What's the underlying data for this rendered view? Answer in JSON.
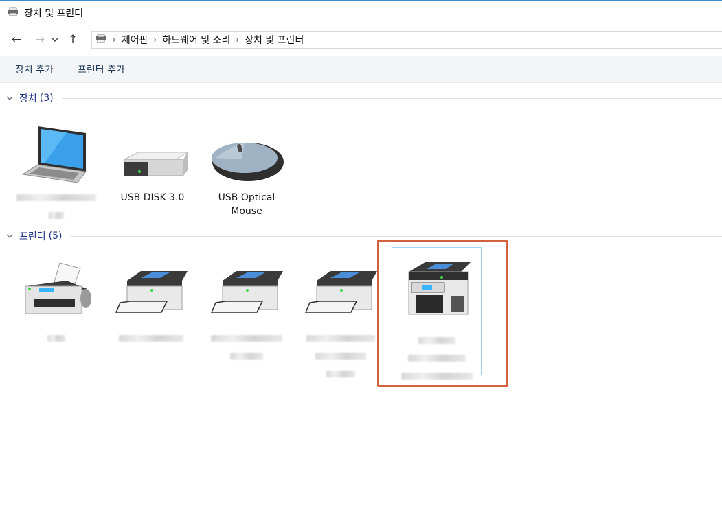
{
  "window": {
    "title": "장치 및 프린터",
    "icon": "devices-printers-icon"
  },
  "nav": {
    "back": "←",
    "forward": "→",
    "recent": "⌄",
    "up": "↑"
  },
  "breadcrumb": {
    "separator": "›",
    "items": [
      "제어판",
      "하드웨어 및 소리",
      "장치 및 프린터"
    ]
  },
  "toolbar": {
    "add_device": "장치 추가",
    "add_printer": "프린터 추가"
  },
  "groups": {
    "devices": {
      "title": "장치",
      "count": "(3)",
      "items": [
        {
          "label": "",
          "icon": "laptop-icon",
          "blurred": true
        },
        {
          "label": "USB DISK 3.0",
          "icon": "usb-drive-icon",
          "blurred": false
        },
        {
          "label": "USB Optical Mouse",
          "icon": "mouse-icon",
          "blurred": false
        }
      ]
    },
    "printers": {
      "title": "프린터",
      "count": "(5)",
      "items": [
        {
          "label": "",
          "icon": "fax-icon",
          "blurred": true
        },
        {
          "label": "",
          "icon": "printer-icon",
          "blurred": true
        },
        {
          "label": "",
          "icon": "printer-icon",
          "blurred": true
        },
        {
          "label": "",
          "icon": "printer-icon",
          "blurred": true
        },
        {
          "label": "",
          "icon": "mfp-printer-icon",
          "blurred": true,
          "selected": true
        }
      ]
    }
  },
  "colors": {
    "accent": "#1e3287",
    "highlight_box": "#d2613f",
    "selection_border": "#9fd0ee"
  }
}
